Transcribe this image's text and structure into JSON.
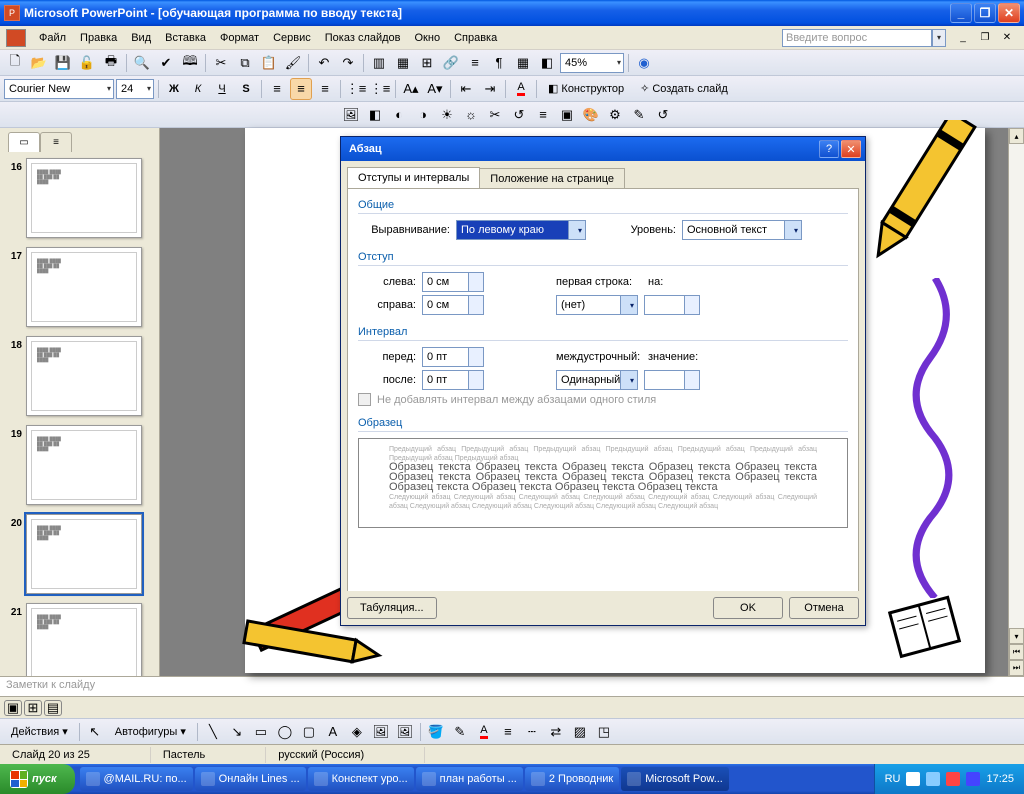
{
  "title": "Microsoft PowerPoint - [обучающая программа по вводу текста]",
  "menu": [
    "Файл",
    "Правка",
    "Вид",
    "Вставка",
    "Формат",
    "Сервис",
    "Показ слайдов",
    "Окно",
    "Справка"
  ],
  "askbox_placeholder": "Введите вопрос",
  "zoom": "45%",
  "font": {
    "name": "Courier New",
    "size": "24"
  },
  "format_btns": {
    "designer": "Конструктор",
    "newslide": "Создать слайд"
  },
  "thumbs": {
    "nums": [
      "16",
      "17",
      "18",
      "19",
      "20",
      "21"
    ],
    "selected": "20"
  },
  "dialog": {
    "title": "Абзац",
    "tabs": [
      "Отступы и интервалы",
      "Положение на странице"
    ],
    "group_general": "Общие",
    "align_label": "Выравнивание:",
    "align_value": "По левому краю",
    "level_label": "Уровень:",
    "level_value": "Основной текст",
    "group_indent": "Отступ",
    "left_label": "слева:",
    "left_value": "0 см",
    "right_label": "справа:",
    "right_value": "0 см",
    "firstline_label": "первая строка:",
    "firstline_value": "(нет)",
    "by_label": "на:",
    "by_value": "",
    "group_spacing": "Интервал",
    "before_label": "перед:",
    "before_value": "0 пт",
    "after_label": "после:",
    "after_value": "0 пт",
    "linespacing_label": "междустрочный:",
    "linespacing_value": "Одинарный",
    "lsby_label": "значение:",
    "lsby_value": "",
    "nosame": "Не добавлять интервал между абзацами одного стиля",
    "group_preview": "Образец",
    "tabs_btn": "Табуляция...",
    "ok": "OK",
    "cancel": "Отмена"
  },
  "notes_placeholder": "Заметки к слайду",
  "draw": {
    "actions": "Действия",
    "autoshapes": "Автофигуры"
  },
  "status": {
    "slide": "Слайд 20 из 25",
    "design": "Пастель",
    "lang": "русский (Россия)"
  },
  "start": "пуск",
  "taskbtns": [
    "@MAIL.RU: по...",
    "Онлайн Lines ...",
    "Конспект уро...",
    "план работы ...",
    "2 Проводник",
    "Microsoft Pow..."
  ],
  "lang_ind": "RU",
  "clock": "17:25"
}
